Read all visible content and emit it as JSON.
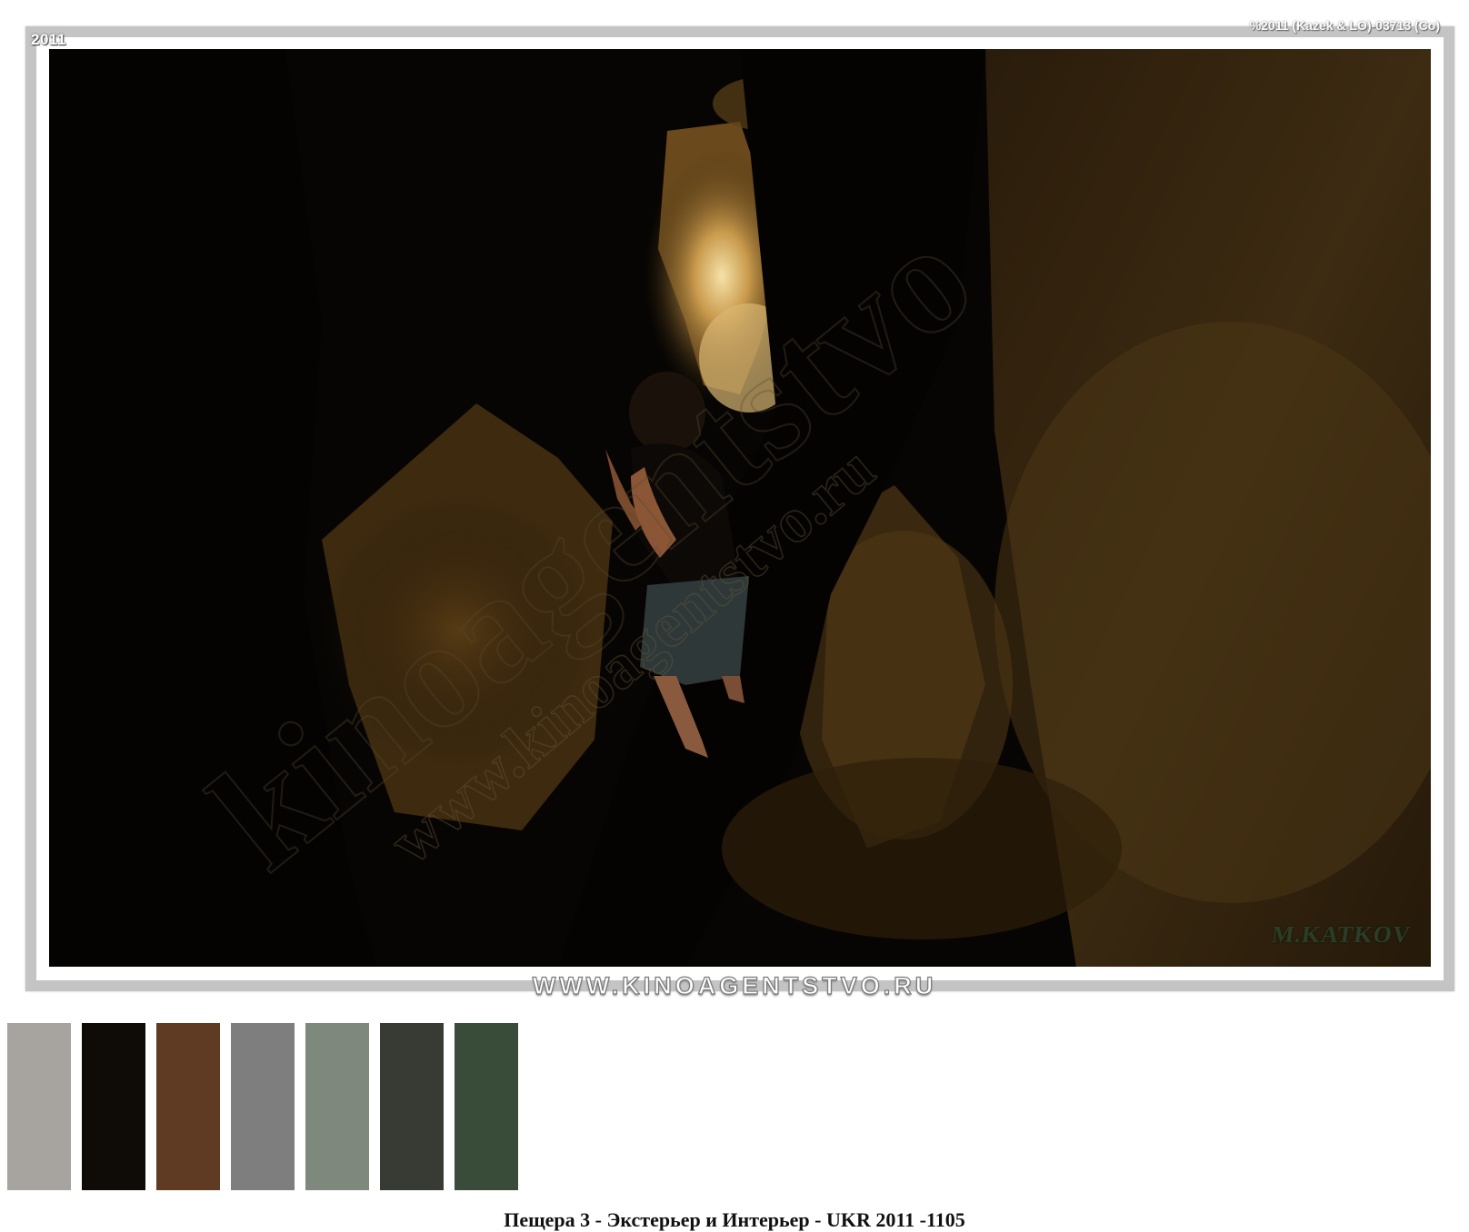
{
  "photo": {
    "year_tag": "2011",
    "code_tag": "%2011 (Kazek & LO)-03713 (Co)",
    "signature": "M.KATKOV",
    "watermark_diagonal": "kinoagentstvo",
    "watermark_url": "www.kinoagentstvo.ru",
    "subject": "person climbing in narrow cave passage"
  },
  "site_banner": "WWW.KINOAGENTSTVO.RU",
  "palette": [
    {
      "name": "swatch-1",
      "color": "#a7a39e"
    },
    {
      "name": "swatch-2",
      "color": "#0f0b07"
    },
    {
      "name": "swatch-3",
      "color": "#603b24"
    },
    {
      "name": "swatch-4",
      "color": "#7e7e7e"
    },
    {
      "name": "swatch-5",
      "color": "#7e887c"
    },
    {
      "name": "swatch-6",
      "color": "#383a34"
    },
    {
      "name": "swatch-7",
      "color": "#394b39"
    }
  ],
  "caption": "Пещера 3 - Экстерьер и Интерьер - UKR 2011 -1105"
}
